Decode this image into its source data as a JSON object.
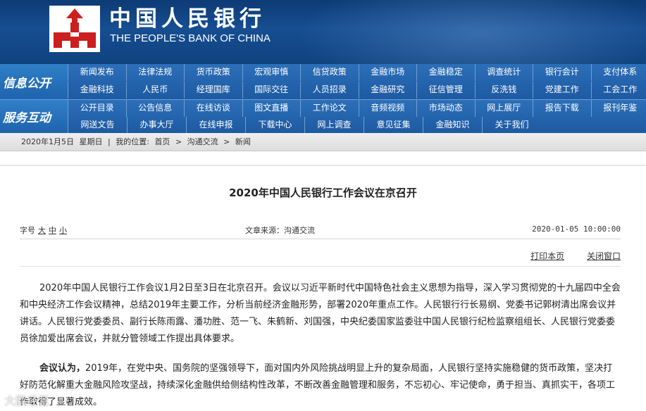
{
  "header": {
    "title_cn": "中国人民银行",
    "title_en": "THE PEOPLE'S BANK OF CHINA"
  },
  "nav": {
    "info": {
      "label": "信息公开",
      "row1": [
        "新闻发布",
        "法律法规",
        "货币政策",
        "宏观审慎",
        "信贷政策",
        "金融市场",
        "金融稳定",
        "调查统计",
        "银行会计",
        "支付体系"
      ],
      "row2": [
        "金融科技",
        "人民币",
        "经理国库",
        "国际交往",
        "人员招录",
        "金融研究",
        "征信管理",
        "反洗钱",
        "党建工作",
        "工会工作"
      ]
    },
    "service": {
      "label": "服务互动",
      "row1": [
        "公开目录",
        "公告信息",
        "在线访谈",
        "图文直播",
        "工作论文",
        "音频视频",
        "市场动态",
        "网上展厅",
        "报告下载",
        "报刊年鉴"
      ],
      "row2": [
        "网送文告",
        "办事大厅",
        "在线申报",
        "下载中心",
        "网上调查",
        "意见征集",
        "金融知识",
        "关于我们"
      ]
    }
  },
  "breadcrumb": {
    "date": "2020年1月5日",
    "weekday": "星期日",
    "prefix": "我的位置:",
    "home": "首页",
    "sep": ">",
    "level1": "沟通交流",
    "level2": "新闻"
  },
  "article": {
    "title": "2020年中国人民银行工作会议在京召开",
    "font_label": "字号",
    "font_large": "大",
    "font_medium": "中",
    "font_small": "小",
    "source": "文章来源：沟通交流",
    "date": "2020-01-05 10:00:00",
    "print": "打印本页",
    "close": "关闭窗口",
    "para1": "2020年中国人民银行工作会议1月2日至3日在北京召开。会议以习近平新时代中国特色社会主义思想为指导，深入学习贯彻党的十九届四中全会和中央经济工作会议精神，总结2019年主要工作，分析当前经济金融形势，部署2020年重点工作。人民银行行长易纲、党委书记郭树清出席会议并讲话。人民银行党委委员、副行长陈雨露、潘功胜、范一飞、朱鹤新、刘国强，中央纪委国家监委驻中国人民银行纪检监察组组长、人民银行党委委员徐加爱出席会议，并就分管领域工作提出具体要求。",
    "para2_lead": "会议认为，",
    "para2": "2019年，在党中央、国务院的坚强领导下，面对国内外风险挑战明显上升的复杂局面，人民银行坚持实施稳健的货币政策，坚决打好防范化解重大金融风险攻坚战，持续深化金融供给侧结构性改革，不断改善金融管理和服务，不忘初心、牢记使命，勇于担当、真抓实干，各项工作取得了显著成效。"
  },
  "watermark": "大鹏经营",
  "colors": {
    "header_bg": "#0f427f",
    "nav_bg": "#1d5aa2",
    "logo_red": "#cc1f1f"
  }
}
